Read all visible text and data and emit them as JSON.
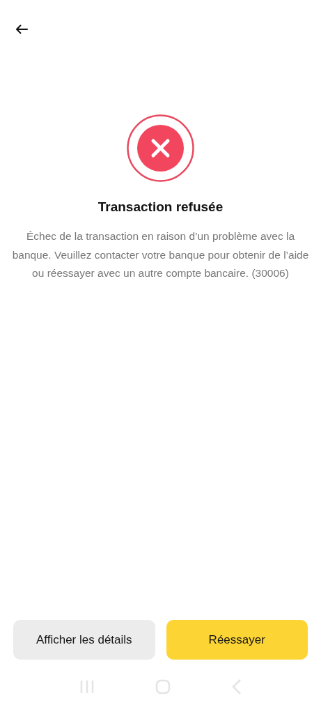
{
  "title": "Transaction refusée",
  "message": "Échec de la transaction en raison d’un problème avec la banque. Veuillez contacter votre banque pour obtenir de l’aide ou réessayer avec un autre compte bancaire. (30006)",
  "buttons": [
    {
      "label": "Afficher les détails",
      "kind": "secondary"
    },
    {
      "label": "Réessayer",
      "kind": "primary"
    }
  ]
}
